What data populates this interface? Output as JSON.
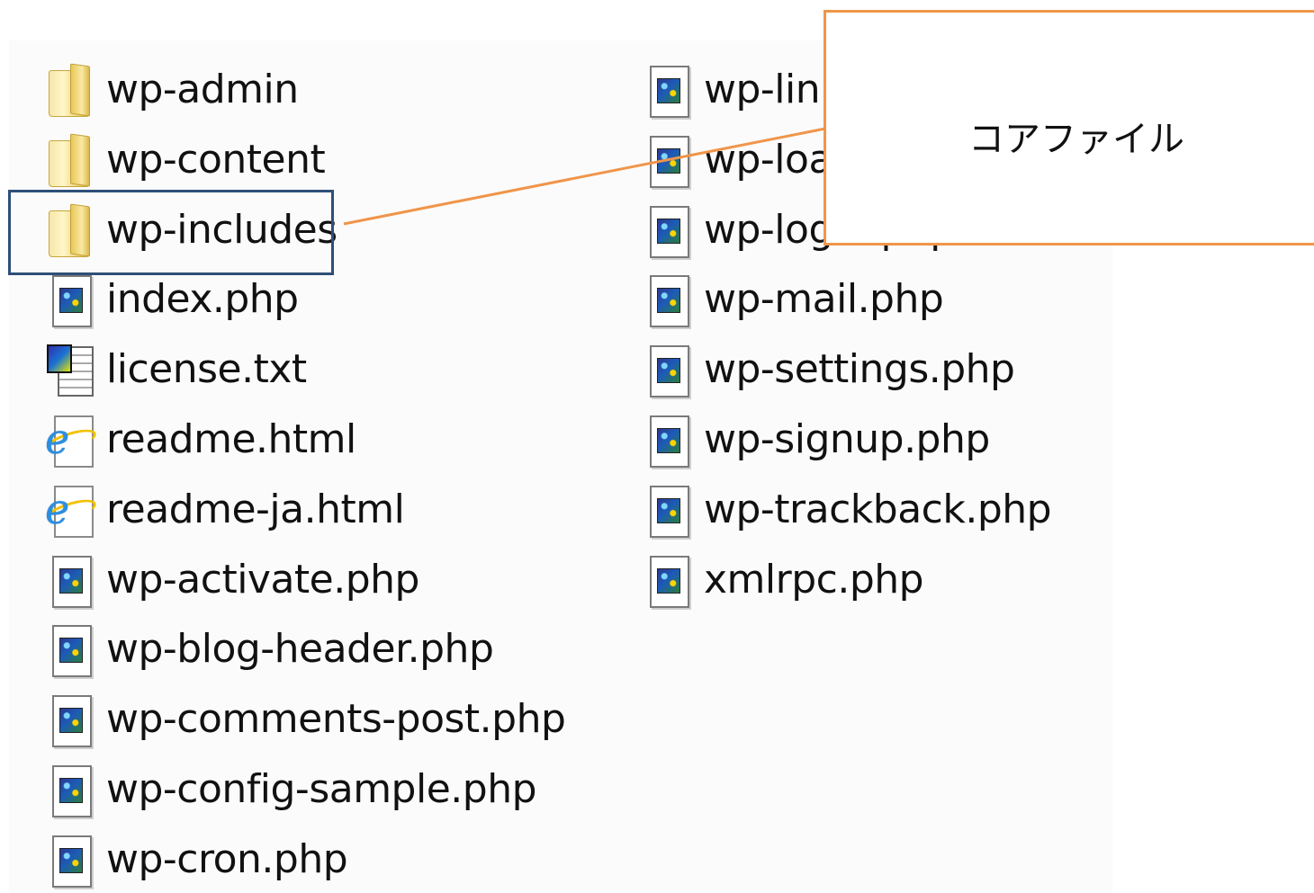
{
  "files": [
    {
      "name": "wp-admin",
      "type": "folder",
      "icon": "folder-icon"
    },
    {
      "name": "wp-content",
      "type": "folder",
      "icon": "folder-icon"
    },
    {
      "name": "wp-includes",
      "type": "folder",
      "icon": "folder-icon",
      "highlighted": true
    },
    {
      "name": "index.php",
      "type": "php",
      "icon": "php-file-icon"
    },
    {
      "name": "license.txt",
      "type": "txt",
      "icon": "text-file-icon"
    },
    {
      "name": "readme.html",
      "type": "html",
      "icon": "ie-file-icon"
    },
    {
      "name": "readme-ja.html",
      "type": "html",
      "icon": "ie-file-icon"
    },
    {
      "name": "wp-activate.php",
      "type": "php",
      "icon": "php-file-icon"
    },
    {
      "name": "wp-blog-header.php",
      "type": "php",
      "icon": "php-file-icon"
    },
    {
      "name": "wp-comments-post.php",
      "type": "php",
      "icon": "php-file-icon"
    },
    {
      "name": "wp-config-sample.php",
      "type": "php",
      "icon": "php-file-icon"
    },
    {
      "name": "wp-cron.php",
      "type": "php",
      "icon": "php-file-icon"
    },
    {
      "name": "wp-links-opml.php",
      "type": "php",
      "icon": "php-file-icon"
    },
    {
      "name": "wp-load.php",
      "type": "php",
      "icon": "php-file-icon"
    },
    {
      "name": "wp-login.php",
      "type": "php",
      "icon": "php-file-icon"
    },
    {
      "name": "wp-mail.php",
      "type": "php",
      "icon": "php-file-icon"
    },
    {
      "name": "wp-settings.php",
      "type": "php",
      "icon": "php-file-icon"
    },
    {
      "name": "wp-signup.php",
      "type": "php",
      "icon": "php-file-icon"
    },
    {
      "name": "wp-trackback.php",
      "type": "php",
      "icon": "php-file-icon"
    },
    {
      "name": "xmlrpc.php",
      "type": "php",
      "icon": "php-file-icon"
    }
  ],
  "callout": {
    "text": "コアファイル",
    "border_color": "#f0954a"
  },
  "highlight": {
    "target": "wp-includes",
    "border_color": "#2e4f79"
  }
}
